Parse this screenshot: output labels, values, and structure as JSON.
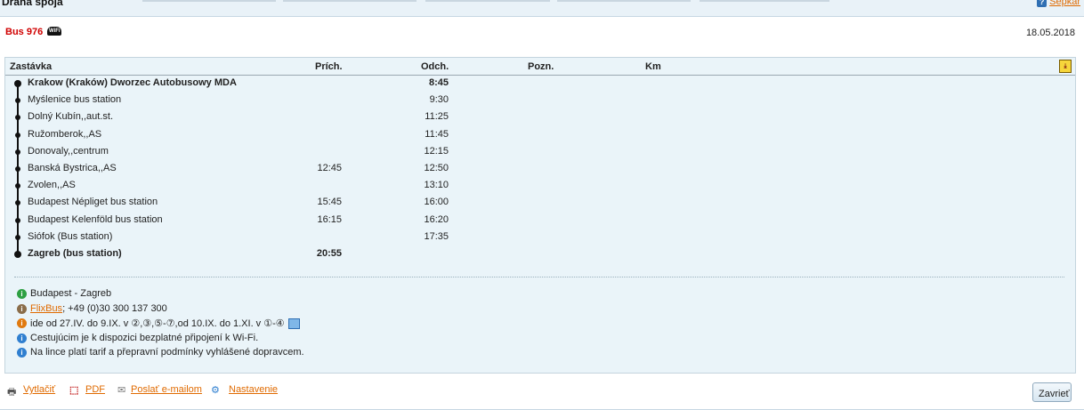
{
  "window": {
    "title": "Dráha spoja",
    "help_label": "Šepkár",
    "help_icon": "question-icon"
  },
  "bus": {
    "line": "Bus 976",
    "wifi_icon": "wifi-icon",
    "date": "18.05.2018"
  },
  "table": {
    "headers": {
      "stop": "Zastávka",
      "arrival": "Prích.",
      "departure": "Odch.",
      "note": "Pozn.",
      "km": "Km"
    },
    "rows": [
      {
        "name": "Krakow (Kraków) Dworzec Autobusowy MDA",
        "arr": "",
        "dep": "8:45"
      },
      {
        "name": "Myślenice bus station",
        "arr": "",
        "dep": "9:30"
      },
      {
        "name": "Dolný Kubín,,aut.st.",
        "arr": "",
        "dep": "11:25"
      },
      {
        "name": "Ružomberok,,AS",
        "arr": "",
        "dep": "11:45"
      },
      {
        "name": "Donovaly,,centrum",
        "arr": "",
        "dep": "12:15"
      },
      {
        "name": "Banská Bystrica,,AS",
        "arr": "12:45",
        "dep": "12:50"
      },
      {
        "name": "Zvolen,,AS",
        "arr": "",
        "dep": "13:10"
      },
      {
        "name": "Budapest Népliget bus station",
        "arr": "15:45",
        "dep": "16:00"
      },
      {
        "name": "Budapest Kelenföld bus station",
        "arr": "16:15",
        "dep": "16:20"
      },
      {
        "name": "Siófok (Bus station)",
        "arr": "",
        "dep": "17:35"
      },
      {
        "name": "Zagreb (bus station)",
        "arr": "20:55",
        "dep": ""
      }
    ]
  },
  "notes": {
    "route": "Budapest - Zagreb",
    "carrier_link": "FlixBus",
    "carrier_phone": "; +49 (0)30 300 137 300",
    "schedule": "ide od 27.IV. do 9.IX. v ②,③,⑤-⑦,od 10.IX. do 1.XI. v ①-④",
    "wifi": "Cestujúcim je k dispozici bezplatné připojení k Wi-Fi.",
    "tariff": "Na lince platí tarif a přepravní podmínky vyhlášené dopravcem."
  },
  "footer": {
    "print": "Vytlačiť",
    "pdf": "PDF",
    "email": "Poslať e-mailom",
    "settings": "Nastavenie",
    "close": "Zavrieť"
  },
  "colors": {
    "accent": "#e06a00",
    "bus_red": "#d00000",
    "panel": "#eaf4f9"
  }
}
